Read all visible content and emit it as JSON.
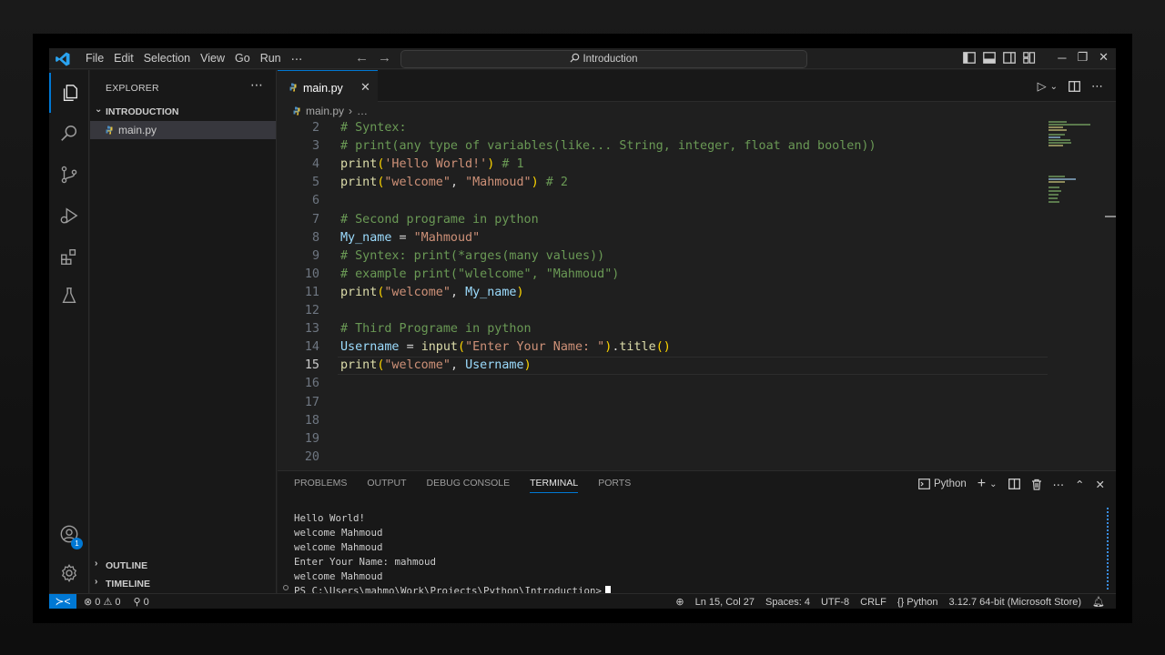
{
  "titlebar": {
    "menu": [
      "File",
      "Edit",
      "Selection",
      "View",
      "Go",
      "Run",
      "⋯"
    ],
    "search_text": "Introduction"
  },
  "sidebar": {
    "title": "EXPLORER",
    "folder": "INTRODUCTION",
    "files": [
      "main.py"
    ],
    "outline": "OUTLINE",
    "timeline": "TIMELINE",
    "accounts_badge": "1"
  },
  "editor": {
    "tab_label": "main.py",
    "breadcrumb_file": "main.py",
    "breadcrumb_more": "…",
    "lines": [
      {
        "n": "2",
        "text": "# Syntex:"
      },
      {
        "n": "3",
        "text": "# print(any type of variables(like... String, integer, float and boolen))"
      },
      {
        "n": "4",
        "text": "print('Hello World!') # 1"
      },
      {
        "n": "5",
        "text": "print(\"welcome\", \"Mahmoud\") # 2"
      },
      {
        "n": "6",
        "text": ""
      },
      {
        "n": "7",
        "text": "# Second programe in python"
      },
      {
        "n": "8",
        "text": "My_name = \"Mahmoud\""
      },
      {
        "n": "9",
        "text": "# Syntex: print(*arges(many values))"
      },
      {
        "n": "10",
        "text": "# example print(\"wlelcome\", \"Mahmoud\")"
      },
      {
        "n": "11",
        "text": "print(\"welcome\", My_name)"
      },
      {
        "n": "12",
        "text": ""
      },
      {
        "n": "13",
        "text": "# Third Programe in python"
      },
      {
        "n": "14",
        "text": "Username = input(\"Enter Your Name: \").title()"
      },
      {
        "n": "15",
        "text": "print(\"welcome\", Username)"
      },
      {
        "n": "16",
        "text": ""
      },
      {
        "n": "17",
        "text": ""
      },
      {
        "n": "18",
        "text": ""
      },
      {
        "n": "19",
        "text": ""
      },
      {
        "n": "20",
        "text": ""
      }
    ],
    "current_line": "15"
  },
  "panel": {
    "tabs": [
      "PROBLEMS",
      "OUTPUT",
      "DEBUG CONSOLE",
      "TERMINAL",
      "PORTS"
    ],
    "active_tab": "TERMINAL",
    "shell": "Python",
    "output": [
      "Hello World!",
      "welcome Mahmoud",
      "welcome Mahmoud",
      "Enter Your Name: mahmoud",
      "welcome Mahmoud"
    ],
    "prompt": "PS C:\\Users\\mahmo\\Work\\Projects\\Python\\Introduction>"
  },
  "statusbar": {
    "errors": "0",
    "warnings": "0",
    "ports": "0",
    "position": "Ln 15, Col 27",
    "spaces": "Spaces: 4",
    "encoding": "UTF-8",
    "eol": "CRLF",
    "language": "Python",
    "interpreter": "3.12.7 64-bit (Microsoft Store)"
  },
  "colors": {
    "accent": "#0078d4",
    "comment": "#6a9955",
    "function": "#dcdcaa",
    "string": "#ce9178",
    "variable": "#9cdcfe"
  }
}
